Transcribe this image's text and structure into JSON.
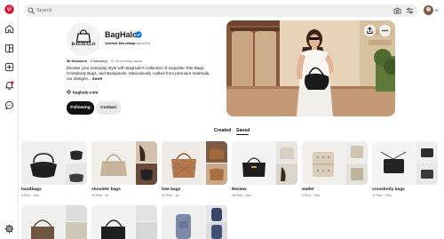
{
  "brand_color": "#e60023",
  "accent_blue": "#0074e8",
  "nav": {
    "items": [
      {
        "name": "pinterest-logo-icon"
      },
      {
        "name": "home-icon"
      },
      {
        "name": "explore-icon"
      },
      {
        "name": "create-icon"
      },
      {
        "name": "notifications-icon"
      },
      {
        "name": "messages-icon"
      },
      {
        "name": "settings-icon"
      }
    ]
  },
  "search": {
    "placeholder": "Search",
    "value": ""
  },
  "profile": {
    "name": "BagHalo",
    "logo_text": "BAGHALO",
    "verified_label": "Verified Merchant",
    "handle": "BagHalo2016",
    "followers_count": "5k followers",
    "separator": " · ",
    "following_count": "0 following",
    "monthly_views": "71.4k monthly views",
    "bio": "Elevate your everyday style with BagHalo's collection of exquisite Tote Bags, Crossbody Bags, and Backpacks. Meticulously crafted from premium materials, our designs...",
    "bio_more": "more",
    "website": "baghalo.com",
    "following_button": "Following",
    "contact_button": "Contact"
  },
  "tabs": {
    "created": "Created",
    "saved": "Saved",
    "active": "Saved"
  },
  "boards": [
    {
      "title": "handbags",
      "pins": "6 Pins",
      "age": "1mo"
    },
    {
      "title": "shoulder bags",
      "pins": "34 Pins",
      "age": "1h"
    },
    {
      "title": "tote bags",
      "pins": "21 Pins",
      "age": "1d"
    },
    {
      "title": "Review",
      "pins": "25 Pins",
      "age": "3wy"
    },
    {
      "title": "wallet",
      "pins": "5 Pins",
      "age": "2mo"
    },
    {
      "title": "crossbody bags",
      "pins": "11 Pins",
      "age": "2mo"
    }
  ],
  "board_meta_separator": " · "
}
